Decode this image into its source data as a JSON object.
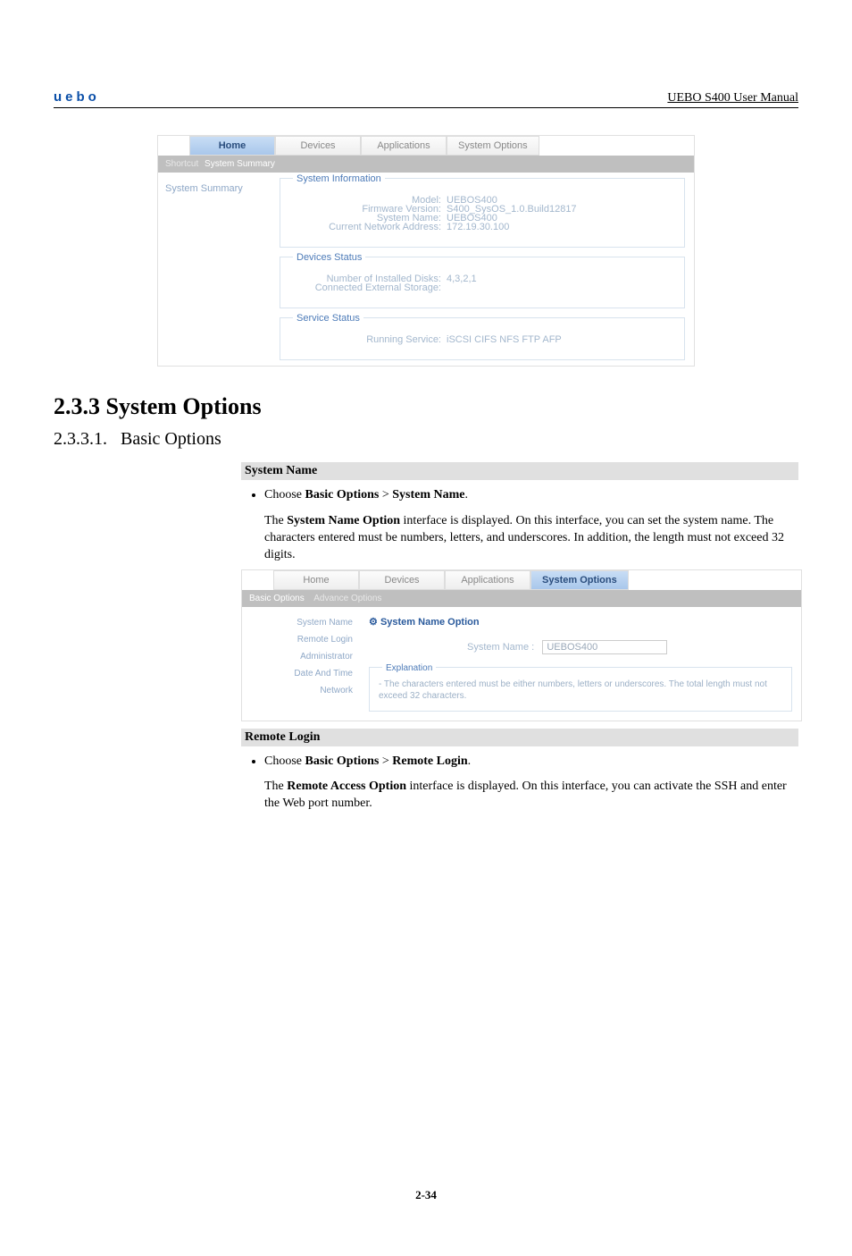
{
  "header": {
    "brand": "uebo",
    "manual": "UEBO S400 User Manual"
  },
  "ss1": {
    "tabs": [
      "Home",
      "Devices",
      "Applications",
      "System Options"
    ],
    "active_tab_index": 0,
    "subtab_prefix": "Shortcut",
    "subtab_active": "System Summary",
    "left_item": "System Summary",
    "fs_sysinfo": {
      "legend": "System Information",
      "rows": [
        {
          "label": "Model:",
          "value": "UEBOS400"
        },
        {
          "label": "Firmware Version:",
          "value": "S400_SysOS_1.0.Build12817"
        },
        {
          "label": "System Name:",
          "value": "UEBOS400"
        },
        {
          "label": "Current Network Address:",
          "value": "172.19.30.100"
        }
      ]
    },
    "fs_devstatus": {
      "legend": "Devices Status",
      "rows": [
        {
          "label": "Number of Installed Disks:",
          "value": "4,3,2,1"
        },
        {
          "label": "Connected External Storage:",
          "value": ""
        }
      ]
    },
    "fs_svcstatus": {
      "legend": "Service Status",
      "rows": [
        {
          "label": "Running Service:",
          "value": "iSCSI CIFS NFS FTP AFP"
        }
      ]
    }
  },
  "doc": {
    "h2": "2.3.3 System Options",
    "h3_num": "2.3.3.1.",
    "h3_text": "Basic Options",
    "system_name": {
      "label": "System Name",
      "bullet_prefix": "Choose ",
      "bullet_b1": "Basic Options",
      "bullet_gt": " > ",
      "bullet_b2": "System Name",
      "bullet_period": ".",
      "p1_pre": "The ",
      "p1_b": "System Name Option",
      "p1_post": " interface is displayed. On this interface, you can set the system name. The characters entered must be numbers, letters, and underscores. In addition, the length must not exceed 32 digits."
    },
    "remote_login": {
      "label": "Remote Login",
      "bullet_prefix": "Choose ",
      "bullet_b1": "Basic Options",
      "bullet_gt": " > ",
      "bullet_b2": "Remote Login",
      "bullet_period": ".",
      "p1_pre": "The ",
      "p1_b": "Remote Access Option",
      "p1_post": " interface is displayed. On this interface, you can activate the SSH and enter the Web port number."
    }
  },
  "ss2": {
    "tabs": [
      "Home",
      "Devices",
      "Applications",
      "System Options"
    ],
    "active_tab_index": 3,
    "subtab_active": "Basic Options",
    "subtab_other": "Advance Options",
    "left_items": [
      "System Name",
      "Remote Login",
      "Administrator",
      "Date And Time",
      "Network"
    ],
    "panel_title": "System Name Option",
    "form": {
      "label": "System Name :",
      "value": "UEBOS400"
    },
    "explanation": {
      "legend": "Explanation",
      "text": "- The characters entered must be either numbers, letters or underscores. The total length must not exceed 32 characters."
    }
  },
  "page_number": "2-34"
}
